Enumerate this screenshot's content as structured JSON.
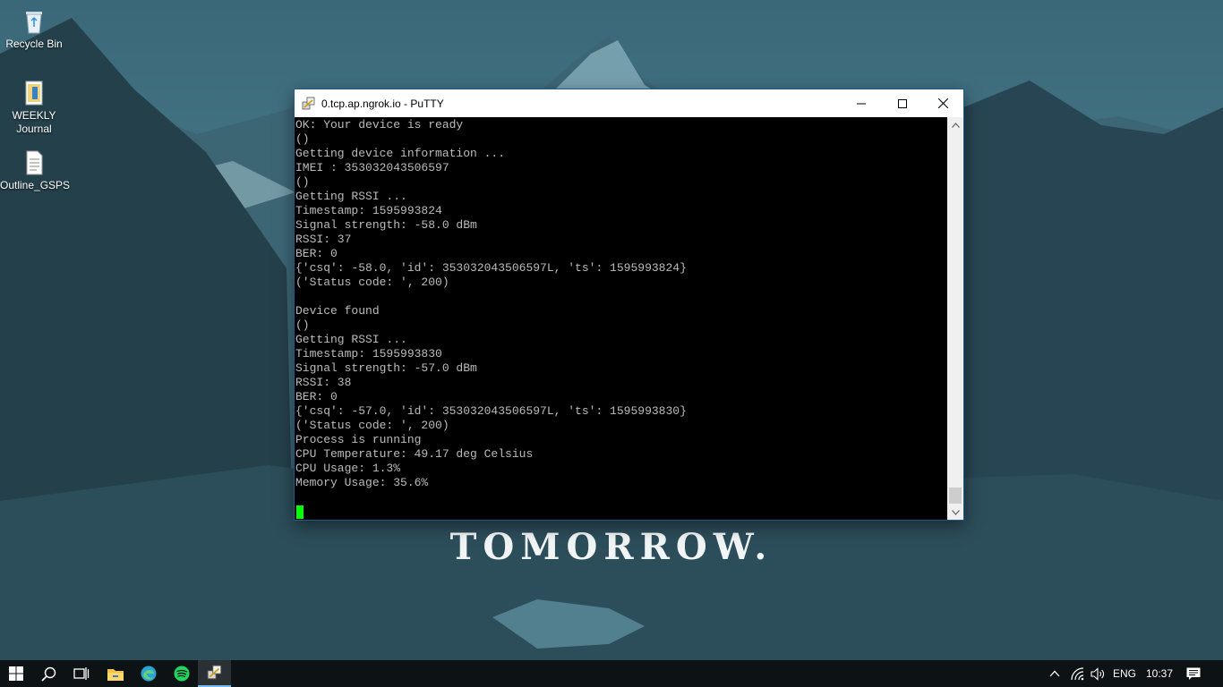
{
  "desktop": {
    "icons": [
      {
        "label": "Recycle Bin",
        "icon": "recycle-bin-icon"
      },
      {
        "label": "WEEKLY Journal",
        "icon": "document-icon"
      },
      {
        "label": "Outline_GSPS",
        "icon": "text-file-icon"
      }
    ],
    "wallpaper_text": "TOMORROW."
  },
  "window": {
    "title": "0.tcp.ap.ngrok.io - PuTTY",
    "app_icon": "putty-icon",
    "controls": [
      "minimize-icon",
      "maximize-icon",
      "close-icon"
    ],
    "terminal": {
      "lines": [
        "OK: Your device is ready",
        "()",
        "Getting device information ...",
        "IMEI : 353032043506597",
        "()",
        "Getting RSSI ...",
        "Timestamp: 1595993824",
        "Signal strength: -58.0 dBm",
        "RSSI: 37",
        "BER: 0",
        "{'csq': -58.0, 'id': 353032043506597L, 'ts': 1595993824}",
        "('Status code: ', 200)",
        "",
        "Device found",
        "()",
        "Getting RSSI ...",
        "Timestamp: 1595993830",
        "Signal strength: -57.0 dBm",
        "RSSI: 38",
        "BER: 0",
        "{'csq': -57.0, 'id': 353032043506597L, 'ts': 1595993830}",
        "('Status code: ', 200)",
        "Process is running",
        "CPU Temperature: 49.17 deg Celsius",
        "CPU Usage: 1.3%",
        "Memory Usage: 35.6%",
        ""
      ],
      "text_color": "#bbbbbb",
      "cursor_color": "#00ff00"
    }
  },
  "taskbar": {
    "items": [
      "start-icon",
      "search-icon",
      "task-view-icon",
      "file-explorer-icon",
      "edge-icon",
      "spotify-icon",
      "putty-icon"
    ],
    "tray": {
      "language": "ENG",
      "time": "10:37"
    }
  }
}
